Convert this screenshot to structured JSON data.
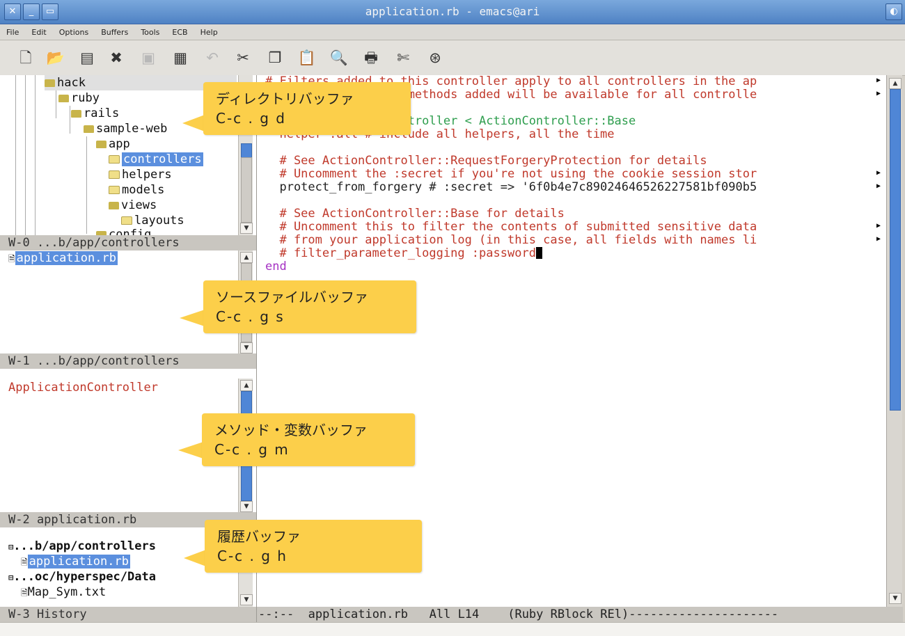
{
  "window": {
    "title": "application.rb - emacs@ari"
  },
  "menu": [
    "File",
    "Edit",
    "Options",
    "Buffers",
    "Tools",
    "ECB",
    "Help"
  ],
  "toolbar_icons": [
    "new-file",
    "open-folder",
    "dired",
    "close",
    "save",
    "save-as",
    "undo",
    "cut",
    "copy",
    "paste",
    "search",
    "print",
    "preferences",
    "help"
  ],
  "directory_pane": {
    "items": [
      {
        "label": "hack",
        "selected": false
      },
      {
        "label": "ruby",
        "selected": false
      },
      {
        "label": "rails",
        "selected": false
      },
      {
        "label": "sample-web",
        "selected": false
      },
      {
        "label": "app",
        "selected": false
      },
      {
        "label": "controllers",
        "selected": true
      },
      {
        "label": "helpers",
        "selected": false
      },
      {
        "label": "models",
        "selected": false
      },
      {
        "label": "views",
        "selected": false
      },
      {
        "label": "layouts",
        "selected": false
      },
      {
        "label": "config",
        "selected": false
      }
    ],
    "modeline": "W-0 ...b/app/controllers"
  },
  "sources_pane": {
    "items": [
      "application.rb"
    ],
    "modeline": "W-1 ...b/app/controllers"
  },
  "methods_pane": {
    "items": [
      "ApplicationController"
    ],
    "modeline": "W-2 application.rb"
  },
  "history_pane": {
    "groups": [
      {
        "label": "...b/app/controllers",
        "child": "application.rb"
      },
      {
        "label": "...oc/hyperspec/Data",
        "child": "Map_Sym.txt"
      }
    ],
    "modeline": "W-3 History"
  },
  "editor": {
    "lines": [
      {
        "text": "# Filters added to this controller apply to all controllers in the ap",
        "cls": "c-comment",
        "wrap": true
      },
      {
        "text": "# Likewise, all the methods added will be available for all controlle",
        "cls": "c-comment",
        "wrap": true
      },
      {
        "text": "",
        "cls": "c-black"
      },
      {
        "text": "class ApplicationController < ActionController::Base",
        "cls": "c-green"
      },
      {
        "text": "  helper :all # include all helpers, all the time",
        "cls": "c-comment"
      },
      {
        "text": "",
        "cls": "c-black"
      },
      {
        "text": "  # See ActionController::RequestForgeryProtection for details",
        "cls": "c-comment"
      },
      {
        "text": "  # Uncomment the :secret if you're not using the cookie session stor",
        "cls": "c-comment",
        "wrap": true
      },
      {
        "text": "  protect_from_forgery # :secret => '6f0b4e7c89024646526227581bf090b5",
        "cls": "c-black",
        "wrap": true
      },
      {
        "text": "",
        "cls": "c-black"
      },
      {
        "text": "  # See ActionController::Base for details",
        "cls": "c-comment"
      },
      {
        "text": "  # Uncomment this to filter the contents of submitted sensitive data",
        "cls": "c-comment",
        "wrap": true
      },
      {
        "text": "  # from your application log (in this case, all fields with names li",
        "cls": "c-comment",
        "wrap": true
      },
      {
        "text": "  # filter_parameter_logging :password",
        "cls": "c-comment",
        "cursor": true
      },
      {
        "text": "end",
        "cls": "c-purple"
      }
    ],
    "modeline": "--:--  application.rb   All L14    (Ruby RBlock REl)---------------------"
  },
  "callouts": [
    {
      "title": "ディレクトリバッファ",
      "keys": "C-c . g d"
    },
    {
      "title": "ソースファイルバッファ",
      "keys": "C-c . g s"
    },
    {
      "title": "メソッド・変数バッファ",
      "keys": "C-c . g m"
    },
    {
      "title": "履歴バッファ",
      "keys": "C-c . g h"
    }
  ],
  "colors": {
    "accent": "#5b8fde",
    "callout": "#fccf4a",
    "comment": "#c0392b",
    "keyword": "#2e9e4e"
  }
}
